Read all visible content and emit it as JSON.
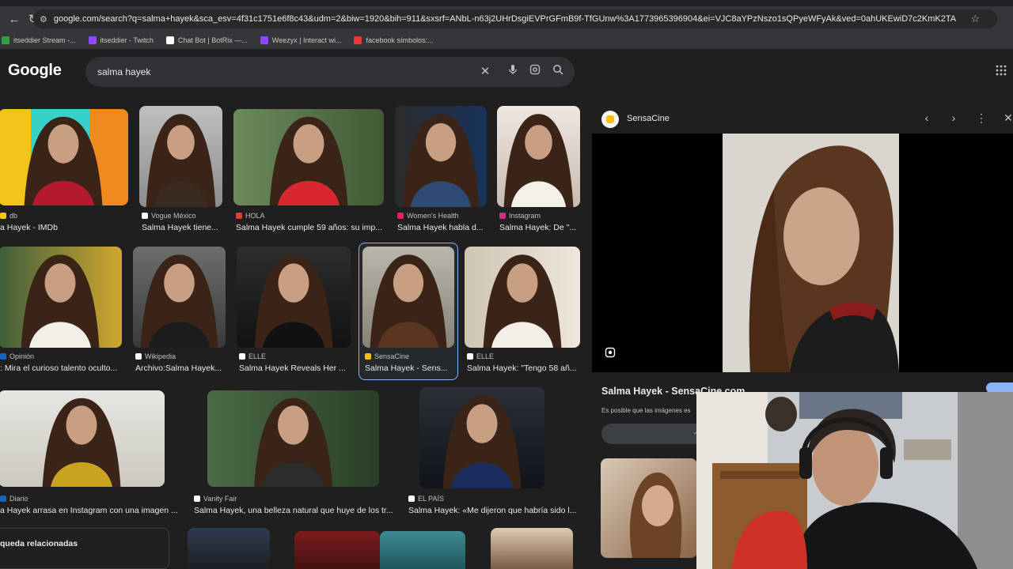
{
  "browser": {
    "url": "google.com/search?q=salma+hayek&sca_esv=4f31c1751e6f8c43&udm=2&biw=1920&bih=911&sxsrf=ANbL-n63j2UHrDsgiEVPrGFmB9f-TfGUnw%3A1773965396904&ei=VJC8aYPzNszo1sQPyeWFyAk&ved=0ahUKEwiD7c2KmK2TAxVMtJUCHclyAZkQ4dUDC...",
    "bookmarks": [
      {
        "label": "itseddier Stream -...",
        "color": "#2ea043"
      },
      {
        "label": "itseddier - Twitch",
        "color": "#9146ff"
      },
      {
        "label": "Chat Bot | BotRix —...",
        "color": "#ffffff"
      },
      {
        "label": "Weezyx | Interact wi...",
        "color": "#9146ff"
      },
      {
        "label": "facebook símbolos:...",
        "color": "#e53935"
      }
    ]
  },
  "search": {
    "logo": "Google",
    "query": "salma hayek"
  },
  "results": [
    {
      "source": "db",
      "title": "a Hayek - IMDb",
      "fav": "#f5c518"
    },
    {
      "source": "Vogue México",
      "title": "Salma Hayek tiene...",
      "fav": "#ffffff"
    },
    {
      "source": "HOLA",
      "title": "Salma Hayek cumple 59 años: su imp...",
      "fav": "#e53935"
    },
    {
      "source": "Women's Health",
      "title": "Salma Hayek habla d...",
      "fav": "#e91e63"
    },
    {
      "source": "Instagram",
      "title": "Salma Hayek: De \"...",
      "fav": "#c13584"
    },
    {
      "source": "Opinión",
      "title": ": Mira el curioso talento oculto...",
      "fav": "#1565c0"
    },
    {
      "source": "Wikipedia",
      "title": "Archivo:Salma Hayek...",
      "fav": "#ffffff"
    },
    {
      "source": "ELLE",
      "title": "Salma Hayek Reveals Her ...",
      "fav": "#ffffff"
    },
    {
      "source": "SensaCine",
      "title": "Salma Hayek - Sens...",
      "fav": "#f9bf0f"
    },
    {
      "source": "ELLE",
      "title": "Salma Hayek: \"Tengo 58 añ...",
      "fav": "#ffffff"
    },
    {
      "source": "Diario",
      "title": "a Hayek arrasa en Instagram con una imagen ...",
      "fav": "#1565c0"
    },
    {
      "source": "Vanity Fair",
      "title": "Salma Hayek, una belleza natural que huye de los tr...",
      "fav": "#ffffff"
    },
    {
      "source": "EL PAÍS",
      "title": "Salma Hayek: «Me dijeron que habría sido l...",
      "fav": "#ffffff"
    }
  ],
  "related": "queda relacionadas",
  "panel": {
    "site": "SensaCine",
    "title": "Salma Hayek - SensaCine.com",
    "note": "Es posible que las imágenes es",
    "share_label": "C"
  },
  "icons": {
    "back": "arrow-left-icon",
    "reload": "reload-icon",
    "star": "star-icon",
    "clear": "close-icon",
    "mic": "microphone-icon",
    "lens": "lens-icon",
    "search": "search-icon",
    "apps": "apps-grid-icon"
  }
}
